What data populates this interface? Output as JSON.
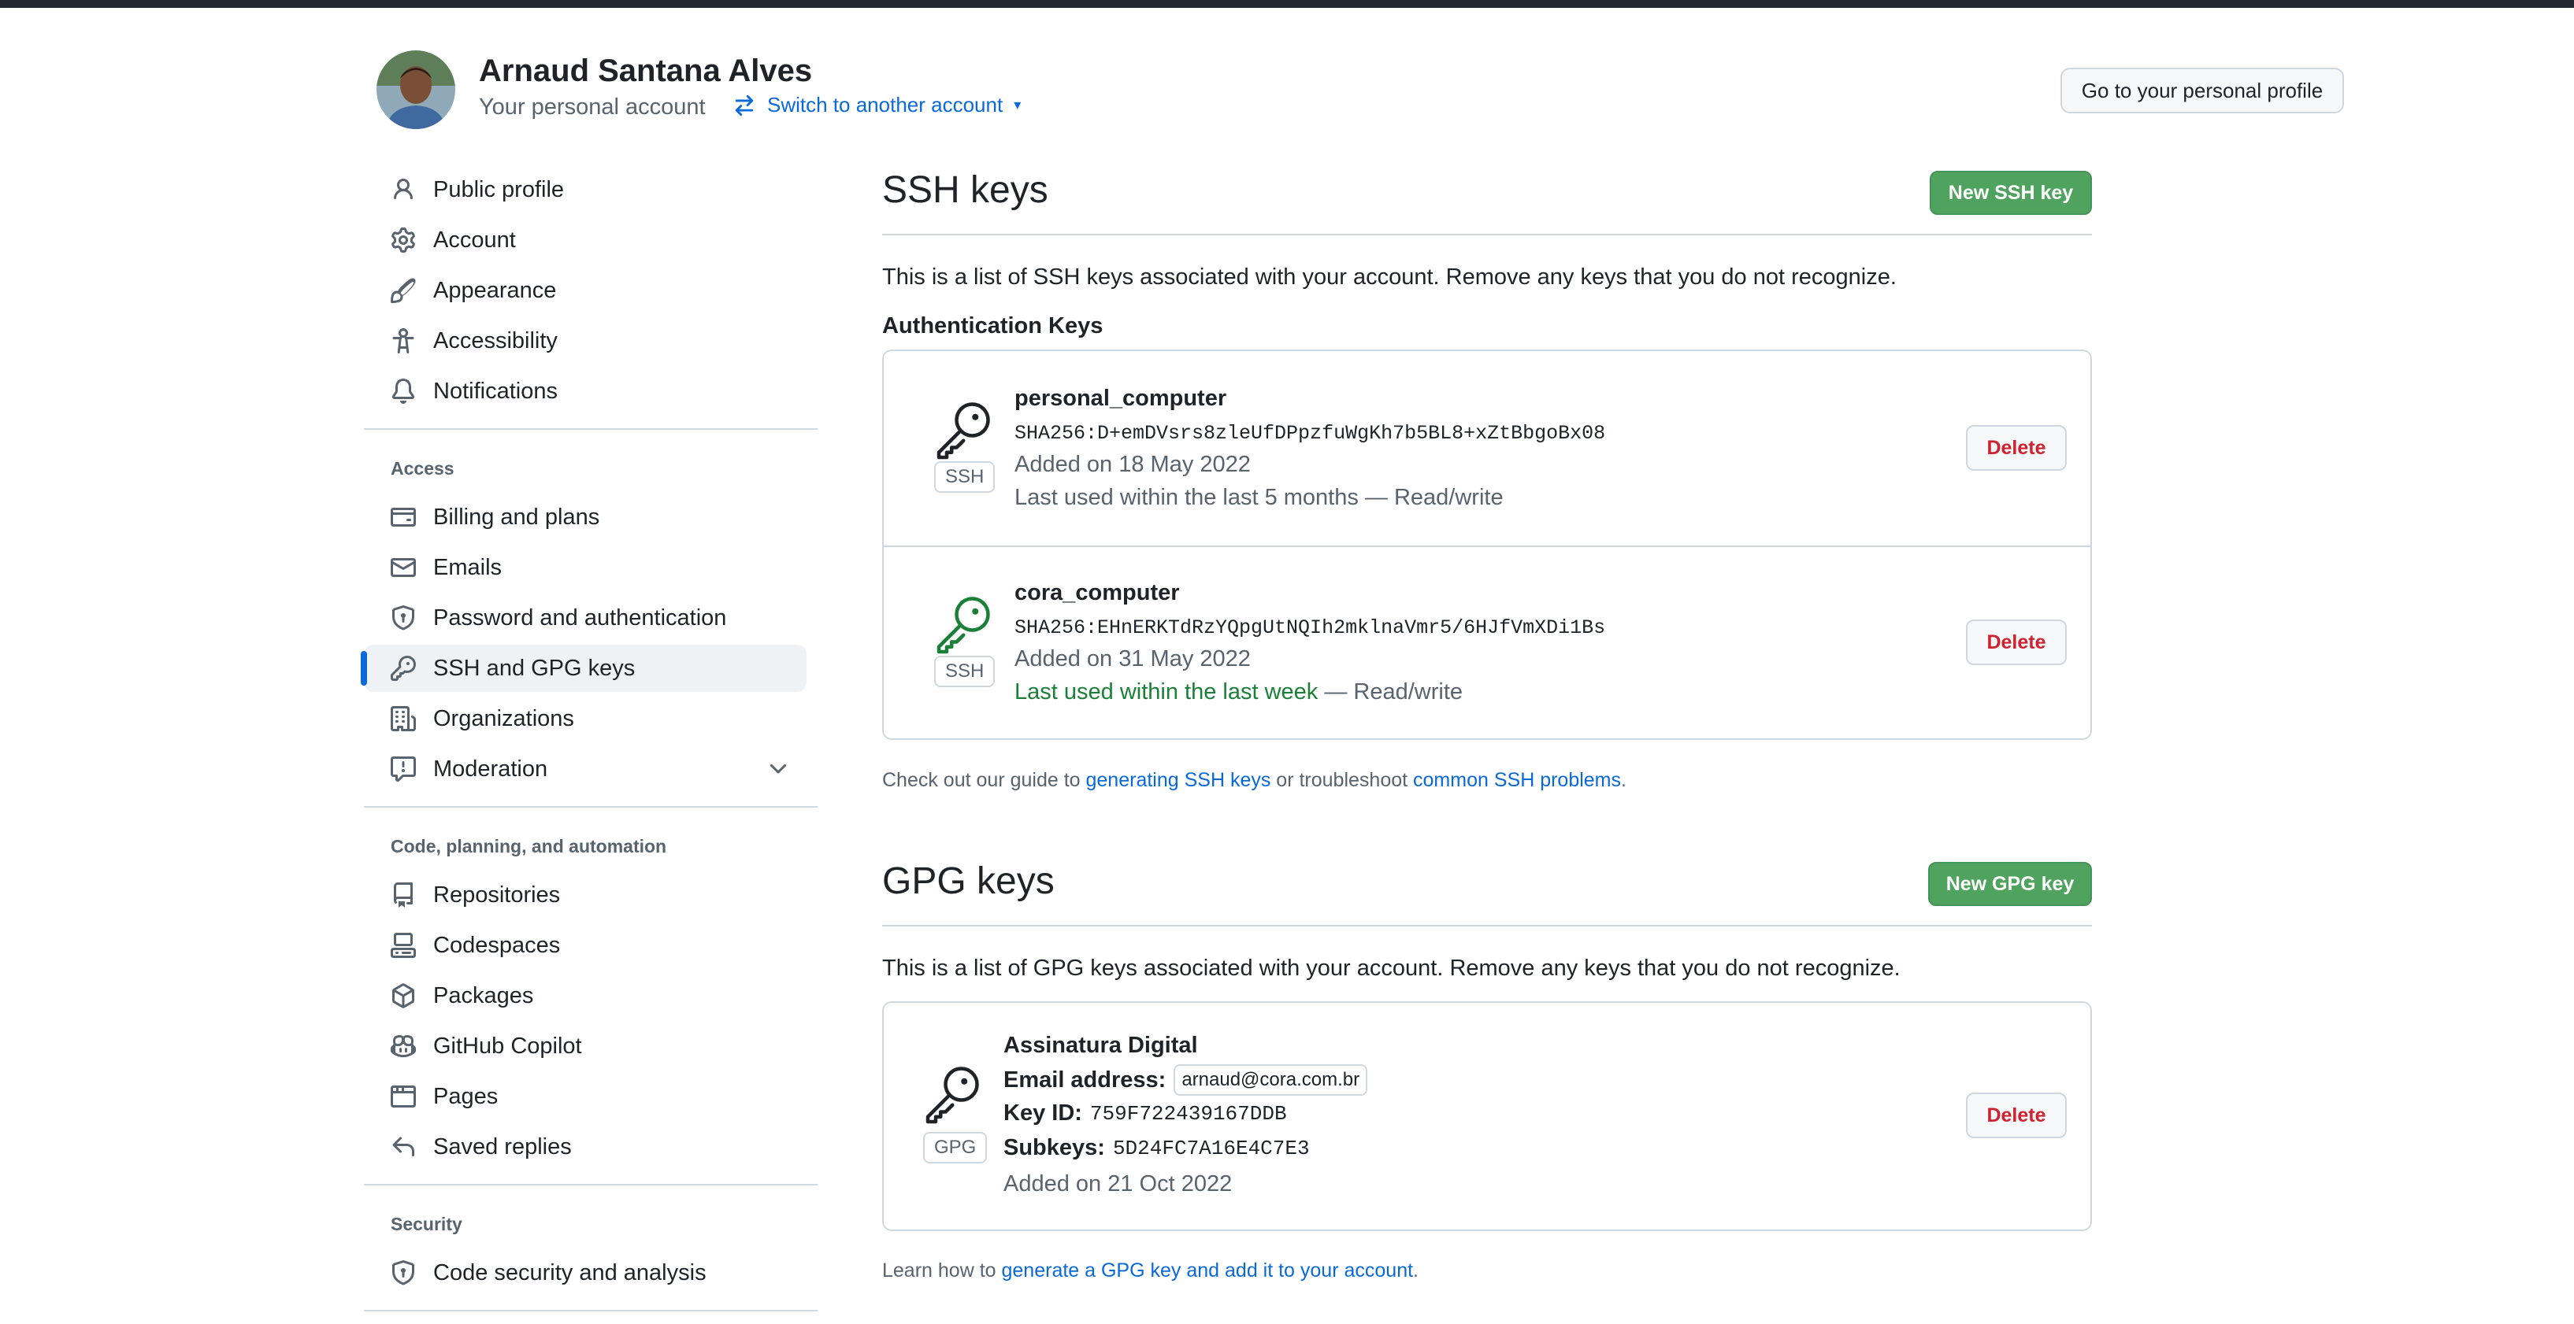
{
  "header": {
    "account_name": "Arnaud Santana Alves",
    "account_subtitle": "Your personal account",
    "switch_label": "Switch to another account",
    "profile_button": "Go to your personal profile"
  },
  "sidebar": {
    "top_items": [
      {
        "label": "Public profile",
        "icon": "person-icon"
      },
      {
        "label": "Account",
        "icon": "gear-icon"
      },
      {
        "label": "Appearance",
        "icon": "paintbrush-icon"
      },
      {
        "label": "Accessibility",
        "icon": "accessibility-icon"
      },
      {
        "label": "Notifications",
        "icon": "bell-icon"
      }
    ],
    "access_heading": "Access",
    "access_items": [
      {
        "label": "Billing and plans",
        "icon": "credit-card-icon"
      },
      {
        "label": "Emails",
        "icon": "mail-icon"
      },
      {
        "label": "Password and authentication",
        "icon": "shield-lock-icon"
      },
      {
        "label": "SSH and GPG keys",
        "icon": "key-icon",
        "active": true
      },
      {
        "label": "Organizations",
        "icon": "organization-icon"
      },
      {
        "label": "Moderation",
        "icon": "report-icon"
      }
    ],
    "code_heading": "Code, planning, and automation",
    "code_items": [
      {
        "label": "Repositories",
        "icon": "repo-icon"
      },
      {
        "label": "Codespaces",
        "icon": "codespaces-icon"
      },
      {
        "label": "Packages",
        "icon": "package-icon"
      },
      {
        "label": "GitHub Copilot",
        "icon": "copilot-icon"
      },
      {
        "label": "Pages",
        "icon": "browser-icon"
      },
      {
        "label": "Saved replies",
        "icon": "reply-icon"
      }
    ],
    "security_heading": "Security",
    "security_items": [
      {
        "label": "Code security and analysis",
        "icon": "shield-lock-icon"
      }
    ]
  },
  "ssh": {
    "title": "SSH keys",
    "new_button": "New SSH key",
    "description": "This is a list of SSH keys associated with your account. Remove any keys that you do not recognize.",
    "subheading": "Authentication Keys",
    "keys": [
      {
        "name": "personal_computer",
        "fingerprint": "SHA256:D+emDVsrs8zleUfDPpzfuWgKh7b5BL8+xZtBbgoBx08",
        "added": "Added on 18 May 2022",
        "last_used": "Last used within the last 5 months — Read/write",
        "badge": "SSH",
        "delete": "Delete"
      },
      {
        "name": "cora_computer",
        "fingerprint": "SHA256:EHnERKTdRzYQpgUtNQIh2mklnaVmr5/6HJfVmXDi1Bs",
        "added": "Added on 31 May 2022",
        "last_used": "Last used within the last week",
        "access": " — Read/write",
        "badge": "SSH",
        "delete": "Delete"
      }
    ],
    "footer_prefix": "Check out our guide to ",
    "footer_link1": "generating SSH keys",
    "footer_mid": " or troubleshoot ",
    "footer_link2": "common SSH problems",
    "footer_suffix": "."
  },
  "gpg": {
    "title": "GPG keys",
    "new_button": "New GPG key",
    "description": "This is a list of GPG keys associated with your account. Remove any keys that you do not recognize.",
    "key": {
      "name": "Assinatura Digital",
      "email_label": "Email address:",
      "email": "arnaud@cora.com.br",
      "keyid_label": "Key ID:",
      "keyid": "759F722439167DDB",
      "subkeys_label": "Subkeys:",
      "subkeys": "5D24FC7A16E4C7E3",
      "added": "Added on 21 Oct 2022",
      "badge": "GPG",
      "delete": "Delete"
    },
    "footer_prefix": "Learn how to ",
    "footer_link": "generate a GPG key and add it to your account",
    "footer_suffix": "."
  },
  "colors": {
    "accent": "#0969da",
    "green_button": "#4fa35f",
    "key_recent": "#1a7f37",
    "danger": "#cf222e"
  }
}
